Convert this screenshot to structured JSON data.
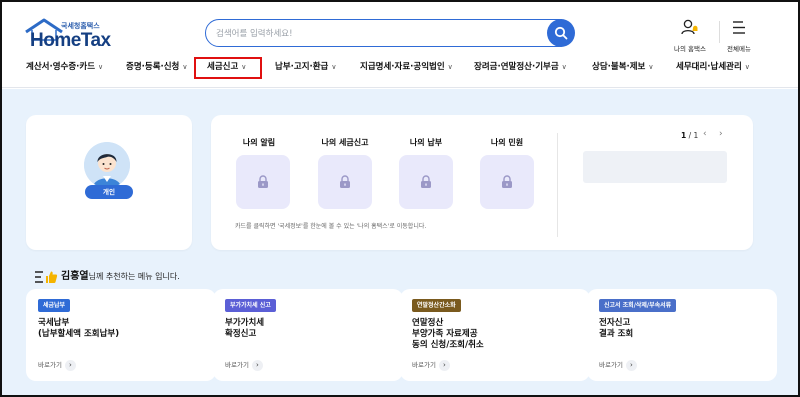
{
  "header": {
    "logo_sub": "국세청홈택스",
    "logo_main": "HomeTax",
    "search_placeholder": "검색어를 입력하세요!",
    "my_hometax_label": "나의 홈택스",
    "all_menu_label": "전체메뉴"
  },
  "gnb": {
    "items": [
      {
        "label": "계산서·영수증·카드"
      },
      {
        "label": "증명·등록·신청"
      },
      {
        "label": "세금신고"
      },
      {
        "label": "납부·고지·환급"
      },
      {
        "label": "지급명세·자료·공익법인"
      },
      {
        "label": "장려금·연말정산·기부금"
      },
      {
        "label": "상담·불복·제보"
      },
      {
        "label": "세무대리·납세관리"
      }
    ],
    "highlighted": "세금신고"
  },
  "profile": {
    "badge": "개인"
  },
  "my_services": {
    "items": [
      {
        "label": "나의 알림"
      },
      {
        "label": "나의 세금신고"
      },
      {
        "label": "나의 납부"
      },
      {
        "label": "나의 민원"
      }
    ],
    "note": "카드를 클릭하면 '국세정보'를 한눈에 볼 수 있는 '나의 홈택스'로 이동합니다.",
    "pager_current": "1",
    "pager_total": "/ 1"
  },
  "recommend": {
    "name": "김홍열",
    "suffix": "님께 추천하는 메뉴 입니다.",
    "cards": [
      {
        "tag": "세금납부",
        "tag_color": "#2f6bd6",
        "title": "국세납부\n(납부할세액 조회납부)",
        "go": "바로가기"
      },
      {
        "tag": "부가가치세 신고",
        "tag_color": "#5b5fd6",
        "title": "부가가치세\n확정신고",
        "go": "바로가기"
      },
      {
        "tag": "연말정산간소화",
        "tag_color": "#7a5a1e",
        "title": "연말정산\n부양가족 자료제공\n동의 신청/조회/취소",
        "go": "바로가기"
      },
      {
        "tag": "신고서 조회/삭제/부속서류",
        "tag_color": "#4a6fc9",
        "title": "전자신고\n결과 조회",
        "go": "바로가기"
      }
    ]
  }
}
